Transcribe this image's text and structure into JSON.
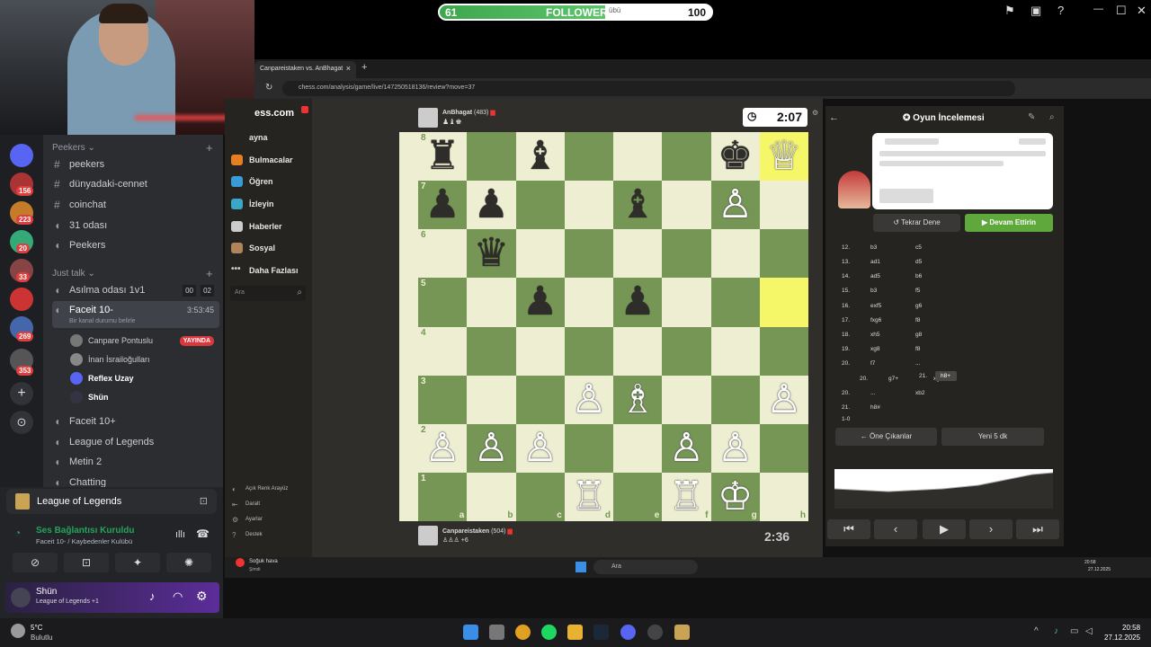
{
  "followers_bar": {
    "label": "FOLLOWERS",
    "left_value": "61",
    "right_value": "100",
    "progress_fraction": 0.61,
    "overlay_fragment": "übü"
  },
  "discord": {
    "servers": [
      {
        "badge": "156"
      },
      {
        "badge": "223"
      },
      {
        "badge": "20"
      },
      {
        "badge": "33"
      },
      {
        "badge": "269"
      },
      {
        "badge": "353"
      }
    ],
    "categories": {
      "peekers": "Peekers",
      "just_talk": "Just talk"
    },
    "text_channels": [
      "peekers",
      "dünyadaki-cennet",
      "coinchat",
      "31 odası",
      "Peekers"
    ],
    "voice_channels": {
      "asilma": {
        "name": "Asılma odası 1v1",
        "count_a": "00",
        "count_b": "02"
      },
      "faceit": {
        "name": "Faceit 10-",
        "timer": "3:53:45",
        "status": "Bir kanal durumu belirle"
      },
      "users": [
        {
          "name": "Canpare Pontuslu",
          "badge": "YAYINDA"
        },
        {
          "name": "İnan İsrailoğulları"
        },
        {
          "name": "Reflex Uzay"
        },
        {
          "name": "Shün"
        }
      ],
      "others": [
        "Faceit 10+",
        "League of Legends",
        "Metin 2",
        "Chatting"
      ]
    },
    "activity": {
      "game": "League of Legends"
    },
    "voice_status": {
      "title": "Ses Bağlantısı Kuruldu",
      "subtitle": "Faceit 10- / Kaybedenler Kulübü"
    },
    "user": {
      "name": "Shün",
      "status": "League of Legends +1"
    }
  },
  "browser": {
    "tab_title": "Canpareistaken vs. AnBhagat",
    "url": "chess.com/analysis/game/live/147250518136/review?move=37"
  },
  "chesscom": {
    "logo": "ess.com",
    "nav": [
      "ayna",
      "Bulmacalar",
      "Öğren",
      "İzleyin",
      "Haberler",
      "Sosyal",
      "Daha Fazlası"
    ],
    "search_placeholder": "Ara",
    "bottom": [
      "Açık Renk Arayüz",
      "Daralt",
      "Ayarlar",
      "Destek"
    ],
    "top_player": {
      "name": "AnBhagat",
      "rating": "(483)",
      "clock": "2:07"
    },
    "bottom_player": {
      "name": "Canpareistaken",
      "rating": "(504)",
      "clock": "2:36",
      "extra": "+6"
    },
    "ranks": [
      "8",
      "7",
      "6",
      "5",
      "4",
      "3",
      "2",
      "1"
    ],
    "files": [
      "a",
      "b",
      "c",
      "d",
      "e",
      "f",
      "g",
      "h"
    ],
    "highlight": [
      "h8",
      "h5"
    ],
    "pieces": {
      "a8": "♜b",
      "c8": "♝b",
      "g8": "♚b",
      "h8": "♕w",
      "a7": "♟b",
      "b7": "♟b",
      "e7": "♝b",
      "g7": "♙w",
      "b6": "♛b",
      "c5": "♟b",
      "e5": "♟b",
      "d3": "♙w",
      "e3": "♗w",
      "h3": "♙w",
      "a2": "♙w",
      "b2": "♙w",
      "c2": "♙w",
      "f2": "♙w",
      "g2": "♙w",
      "d1": "♖w",
      "f1": "♖w",
      "g1": "♔w"
    }
  },
  "review": {
    "title": "Oyun İncelemesi",
    "retry": "Tekrar Dene",
    "continue": "Devam Ettirin",
    "moves": [
      {
        "n": "12.",
        "w": "b3",
        "b": "c5"
      },
      {
        "n": "13.",
        "w": "ad1",
        "b": "d5"
      },
      {
        "n": "14.",
        "w": "ad5",
        "b": "b6"
      },
      {
        "n": "15.",
        "w": "b3",
        "b": "f5"
      },
      {
        "n": "16.",
        "w": "exf5",
        "b": "g6"
      },
      {
        "n": "17.",
        "w": "fxg6",
        "b": "f8"
      },
      {
        "n": "18.",
        "w": "xh5",
        "b": "g8"
      },
      {
        "n": "19.",
        "w": "xg8",
        "b": "f8"
      },
      {
        "n": "20.",
        "w": "f7",
        "b": "..."
      },
      {
        "n": "20.",
        "w": "g7+",
        "b": "xg8"
      },
      {
        "n": "20.",
        "w": "...",
        "b": "xb2"
      },
      {
        "n": "21.",
        "w": "h8#",
        "b": ""
      }
    ],
    "variation_tail": "21.",
    "variation_last": "h8+",
    "result": "1-0",
    "back": "Öne Çıkanlar",
    "new": "Yeni 5 dk"
  },
  "inner_taskbar": {
    "weather": "Soğuk hava",
    "weather_sub": "Şimdi",
    "search": "Ara",
    "time": "20:58",
    "date": "27.12.2025"
  },
  "taskbar": {
    "temp": "5°C",
    "weather": "Bulutlu",
    "time": "20:58",
    "date": "27.12.2025"
  }
}
